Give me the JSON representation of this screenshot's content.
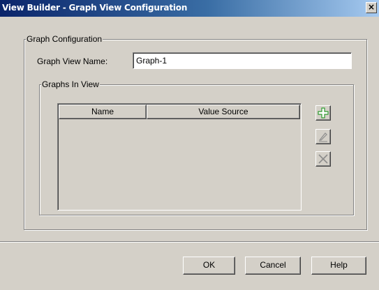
{
  "window": {
    "title": "View Builder - Graph View Configuration",
    "close_glyph": "×"
  },
  "graph_config": {
    "legend": "Graph Configuration",
    "name_label": "Graph View Name:",
    "name_value": "Graph-1"
  },
  "graphs_in_view": {
    "legend": "Graphs In View",
    "columns": [
      "Name",
      "Value Source"
    ],
    "rows": [],
    "actions": [
      {
        "name": "add-icon",
        "enabled": true
      },
      {
        "name": "edit-icon",
        "enabled": false
      },
      {
        "name": "delete-icon",
        "enabled": false
      }
    ]
  },
  "footer": {
    "ok_label": "OK",
    "cancel_label": "Cancel",
    "help_label": "Help"
  },
  "colors": {
    "title_start": "#0a246a",
    "title_end": "#a6caf0",
    "add_icon": "#2e9b2e",
    "disabled_icon": "#8c8c8c"
  }
}
